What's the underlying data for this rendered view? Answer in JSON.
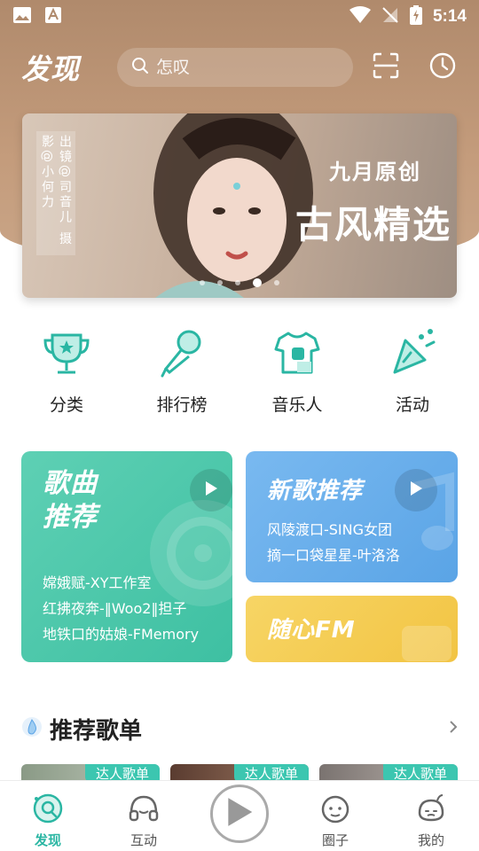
{
  "status_bar": {
    "time": "5:14"
  },
  "header": {
    "app_title": "发现",
    "search_placeholder": "怎叹"
  },
  "banner": {
    "credit": "出镜@司音儿 摄影@小何力",
    "subtitle": "九月原创",
    "title": "古风精选",
    "dots": 5,
    "active_dot": 4
  },
  "quick_nav": [
    {
      "label": "分类",
      "icon": "trophy-icon"
    },
    {
      "label": "排行榜",
      "icon": "microphone-icon"
    },
    {
      "label": "音乐人",
      "icon": "tshirt-icon"
    },
    {
      "label": "活动",
      "icon": "party-popper-icon"
    }
  ],
  "cards": {
    "songs": {
      "title_line1": "歌曲",
      "title_line2": "推荐",
      "items": [
        "嫦娥赋-XY工作室",
        "红拂夜奔-‖Woo2‖担子",
        "地铁口的姑娘-FMemory"
      ]
    },
    "new_songs": {
      "title": "新歌推荐",
      "items": [
        "风陵渡口-SING女团",
        "摘一口袋星星-叶洛洛"
      ]
    },
    "fm": {
      "title": "随心FM"
    }
  },
  "section": {
    "title": "推荐歌单"
  },
  "playlists": [
    {
      "tag": "达人歌单"
    },
    {
      "tag": "达人歌单"
    },
    {
      "tag": "达人歌单"
    }
  ],
  "tabbar": [
    {
      "label": "发现",
      "icon": "discover-icon",
      "active": true
    },
    {
      "label": "互动",
      "icon": "headphones-icon",
      "active": false
    },
    {
      "label": "圈子",
      "icon": "circle-face-icon",
      "active": false
    },
    {
      "label": "我的",
      "icon": "profile-face-icon",
      "active": false
    }
  ],
  "colors": {
    "header": "#b08a6c",
    "accent": "#2ab6a3",
    "songs_card": "#4ec7ab",
    "new_card": "#68aeeb",
    "fm_card": "#f4cb52"
  }
}
